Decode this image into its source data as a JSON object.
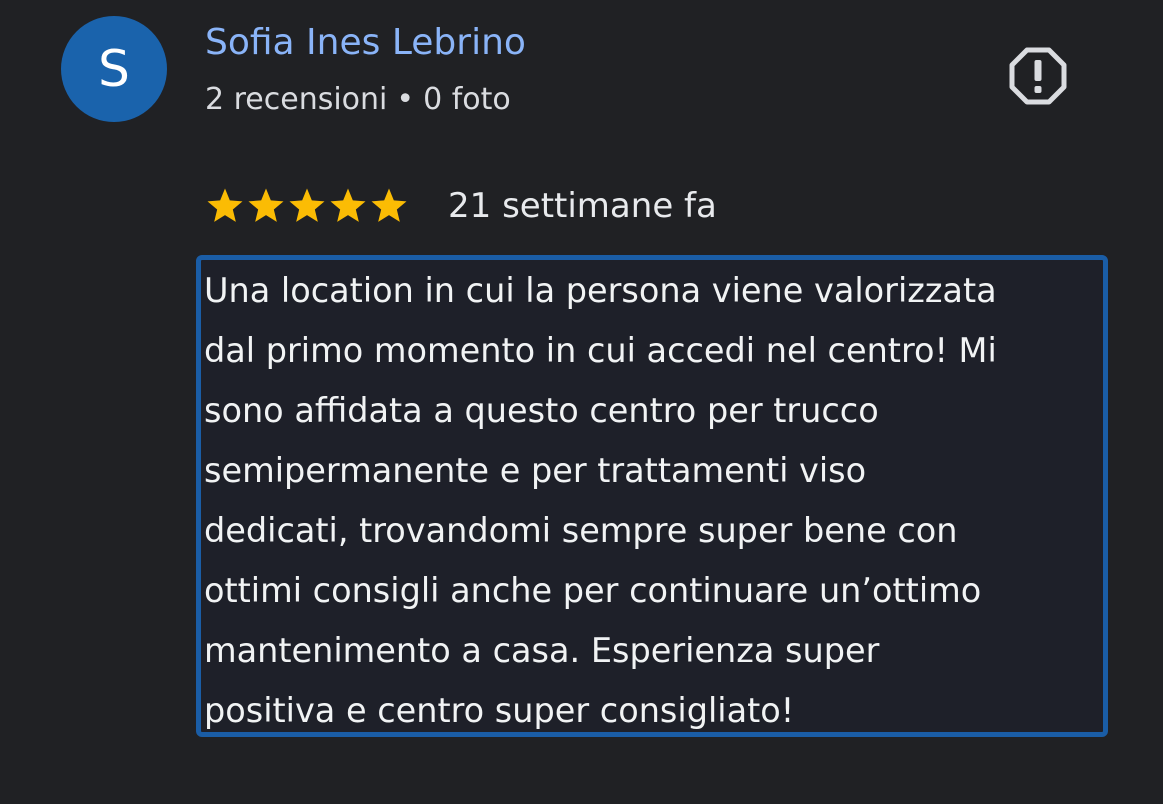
{
  "reviewer": {
    "avatar_letter": "S",
    "name": "Sofia Ines Lebrino",
    "reviews_count": "2 recensioni",
    "separator": "•",
    "photos_count": "0 foto"
  },
  "report": {
    "icon": "report-octagon-icon"
  },
  "review": {
    "rating": 5,
    "rating_max": 5,
    "date": "21 settimane fa",
    "text": "Una location in cui la persona viene valorizzata\ndal primo momento in cui accedi nel centro! Mi\nsono affidata a questo centro per trucco\nsemipermanente e per trattamenti viso\ndedicati, trovandomi sempre super bene con\nottimi consigli anche per continuare un’ottimo\nmantenimento a casa. Esperienza super\npositiva e centro super consigliato!"
  },
  "colors": {
    "background": "#202124",
    "name": "#8ab4f8",
    "avatar": "#1a63ac",
    "star": "#fbbc04",
    "selection_border": "#1a5da6"
  }
}
